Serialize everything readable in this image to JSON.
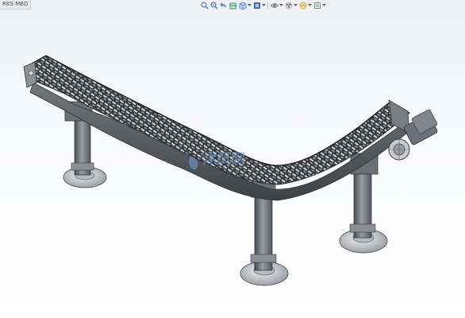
{
  "window": {
    "tab_label": "RKS MBD"
  },
  "heads_up_toolbar": {
    "items": [
      {
        "icon": "zoom-to-fit-icon",
        "color": "#5a79b8"
      },
      {
        "icon": "zoom-to-area-icon",
        "color": "#5a79b8"
      },
      {
        "icon": "previous-view-icon",
        "color": "#5a79b8"
      },
      {
        "icon": "section-view-icon",
        "color": "#3f8f6b"
      },
      {
        "icon": "view-orientation-icon",
        "color": "#4f76c2"
      },
      {
        "icon": "display-style-icon",
        "color": "#4f76c2"
      },
      {
        "icon": "hide-show-items-icon",
        "color": "#6b6f79"
      },
      {
        "icon": "edit-appearance-icon",
        "color": "#d8504a"
      },
      {
        "icon": "apply-scene-icon",
        "color": "#c9a53a"
      },
      {
        "icon": "view-settings-icon",
        "color": "#6b6f79"
      }
    ]
  },
  "model": {
    "name": "conveyor-assembly",
    "colors": {
      "chain_dark": "#3a3b40",
      "chain_light": "#d6d7dc",
      "frame": "#5c5e66",
      "leg": "#7d7f88",
      "base_plate": "#c9cbd1",
      "motor": "#6e7079"
    }
  },
  "watermark": {
    "text": "沐风网",
    "color": "#6fa3d6"
  }
}
